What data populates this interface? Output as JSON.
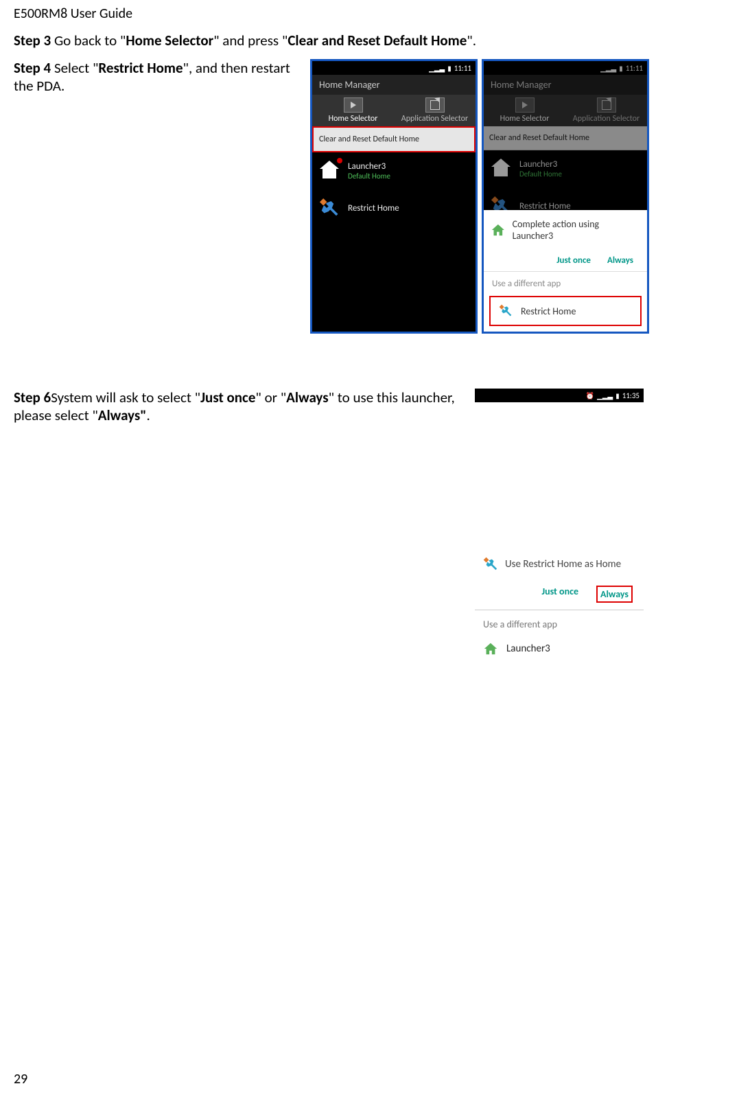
{
  "doc": {
    "header": "E500RM8 User Guide",
    "page_number": "29"
  },
  "step3": {
    "prefix": "Step 3 ",
    "t1": "Go back to \"",
    "b1": "Home Selector",
    "t2": "\" and press \"",
    "b2": "Clear and Reset Default Home",
    "t3": "\"."
  },
  "step4": {
    "prefix": "Step 4 ",
    "t1": "Select \"",
    "b1": "Restrict Home",
    "t2": "\", and then restart the PDA."
  },
  "step6": {
    "prefix": "Step 6",
    "t1": "System will ask to select \"",
    "b1": "Just once",
    "t2": "\" or \"",
    "b2": "Always",
    "t3": "\" to use this launcher, please select \"",
    "b3": "Always\"",
    "t4": "."
  },
  "phone_common": {
    "time": "11:11",
    "hm_title": "Home Manager",
    "tab_home": "Home Selector",
    "tab_app": "Application Selector",
    "clear_reset": "Clear and Reset Default Home",
    "launcher3": "Launcher3",
    "default_home": "Default Home",
    "restrict_home": "Restrict Home"
  },
  "phone2_popup": {
    "title": "Complete action using Launcher3",
    "just_once": "Just once",
    "always": "Always",
    "use_diff": "Use a different app",
    "restrict_home": "Restrict Home"
  },
  "phone3": {
    "time": "11:35",
    "title": "Use Restrict Home as Home",
    "just_once": "Just once",
    "always": "Always",
    "use_diff": "Use a different app",
    "launcher3": "Launcher3"
  }
}
